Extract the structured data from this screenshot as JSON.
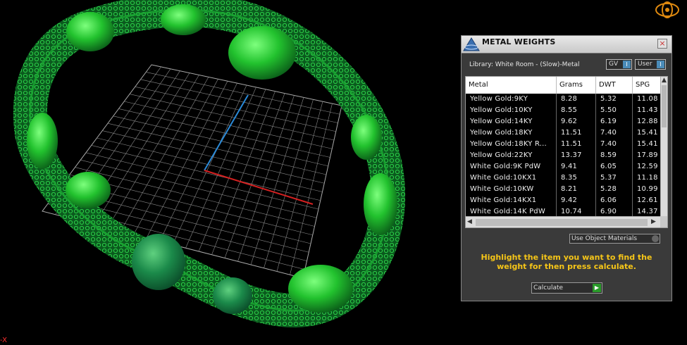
{
  "axis": {
    "x_label": "-X"
  },
  "panel": {
    "title": "METAL WEIGHTS",
    "close": "×",
    "library": "Library: White Room - (Slow)-Metal",
    "toggles": [
      {
        "label": "GV",
        "indicator": "I"
      },
      {
        "label": "User",
        "indicator": "I"
      }
    ],
    "table": {
      "columns": [
        "Metal",
        "Grams",
        "DWT",
        "SPG"
      ],
      "rows": [
        [
          "Yellow Gold:9KY",
          "8.28",
          "5.32",
          "11.08"
        ],
        [
          "Yellow Gold:10KY",
          "8.55",
          "5.50",
          "11.43"
        ],
        [
          "Yellow Gold:14KY",
          "9.62",
          "6.19",
          "12.88"
        ],
        [
          "Yellow Gold:18KY",
          "11.51",
          "7.40",
          "15.41"
        ],
        [
          "Yellow Gold:18KY R...",
          "11.51",
          "7.40",
          "15.41"
        ],
        [
          "Yellow Gold:22KY",
          "13.37",
          "8.59",
          "17.89"
        ],
        [
          "White Gold:9K PdW",
          "9.41",
          "6.05",
          "12.59"
        ],
        [
          "White Gold:10KX1",
          "8.35",
          "5.37",
          "11.18"
        ],
        [
          "White Gold:10KW",
          "8.21",
          "5.28",
          "10.99"
        ],
        [
          "White Gold:14KX1",
          "9.42",
          "6.06",
          "12.61"
        ],
        [
          "White Gold:14K PdW",
          "10.74",
          "6.90",
          "14.37"
        ]
      ]
    },
    "use_object_materials": "Use Object Materials",
    "hint": "Highlight the item you want to find the weight for then press calculate.",
    "calculate": "Calculate",
    "calculate_icon": "play-icon"
  },
  "colors": {
    "ring_green": "#1fa82a",
    "ring_dark": "#0a6a22",
    "grid": "#9a9a9a",
    "axis_red": "#d42020",
    "axis_blue": "#2a8ad8",
    "hint_yellow": "#f5c518"
  }
}
